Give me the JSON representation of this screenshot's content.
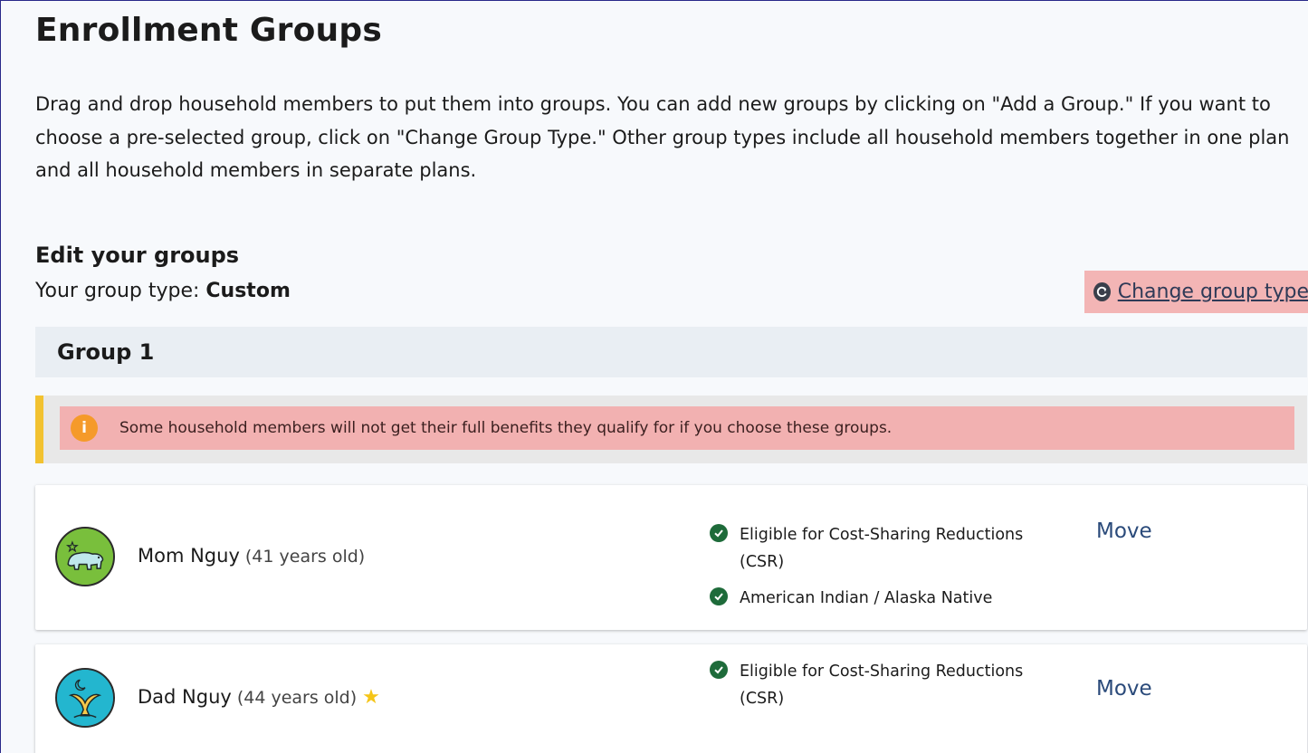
{
  "page": {
    "title": "Enrollment Groups",
    "intro": "Drag and drop household members to put them into groups. You can add new groups by clicking on \"Add a Group.\" If you want to choose a pre-selected group, click on \"Change Group Type.\" Other group types include all household members together in one plan and all household members in separate plans."
  },
  "edit": {
    "title": "Edit your groups",
    "group_type_label": "Your group type:",
    "group_type_value": "Custom",
    "change_link": "Change group type"
  },
  "group": {
    "title": "Group 1",
    "warning": "Some household members will not get their full benefits they qualify for if you choose these groups.",
    "warning_icon": "i"
  },
  "members": [
    {
      "name": "Mom Nguy",
      "age": "(41 years old)",
      "avatar_icon": "bear-icon",
      "eligibility": [
        "Eligible for Cost-Sharing Reductions (CSR)",
        "American Indian / Alaska Native"
      ],
      "move_label": "Move"
    },
    {
      "name": "Dad Nguy",
      "age": "(44 years old)",
      "avatar_icon": "whale-tail-icon",
      "primary_star": "★",
      "eligibility": [
        "Eligible for Cost-Sharing Reductions (CSR)"
      ],
      "move_label": "Move"
    }
  ],
  "colors": {
    "highlight": "#f3b5b5",
    "warning_bar": "#f2c230",
    "warning_icon": "#f59a2a",
    "check": "#1e6b3a",
    "link": "#2a4a7a"
  }
}
